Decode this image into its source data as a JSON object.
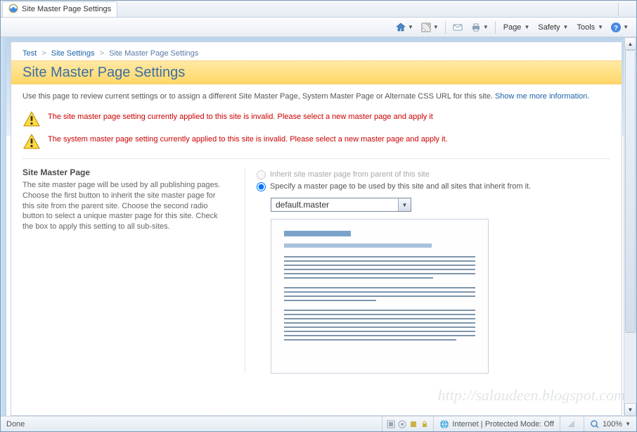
{
  "window": {
    "tab_title": "Site Master Page Settings"
  },
  "cmdbar": {
    "page": "Page",
    "safety": "Safety",
    "tools": "Tools"
  },
  "breadcrumb": {
    "a": "Test",
    "b": "Site Settings",
    "c": "Site Master Page Settings"
  },
  "page_title": "Site Master Page Settings",
  "description": "Use this page to review current settings or to assign a different Site Master Page, System Master Page or Alternate CSS URL for this site.",
  "description_link": "Show me more information.",
  "warning1": "The site master page setting currently applied to this site is invalid. Please select a new master page and apply it",
  "warning2": "The system master page setting currently applied to this site is invalid. Please select a new master page and apply it.",
  "section": {
    "title": "Site Master Page",
    "body": "The site master page will be used by all publishing pages. Choose the first button to inherit the site master page for this site from the parent site. Choose the second radio button to select a unique master page for this site. Check the box to apply this setting to all sub-sites.",
    "opt_inherit": "Inherit site master page from parent of this site",
    "opt_specify": "Specify a master page to be used by this site and all sites that inherit from it.",
    "combo_value": "default.master"
  },
  "status": {
    "done": "Done",
    "zone": "Internet | Protected Mode: Off",
    "zoom": "100%"
  },
  "watermark": "http://salaudeen.blogspot.com"
}
